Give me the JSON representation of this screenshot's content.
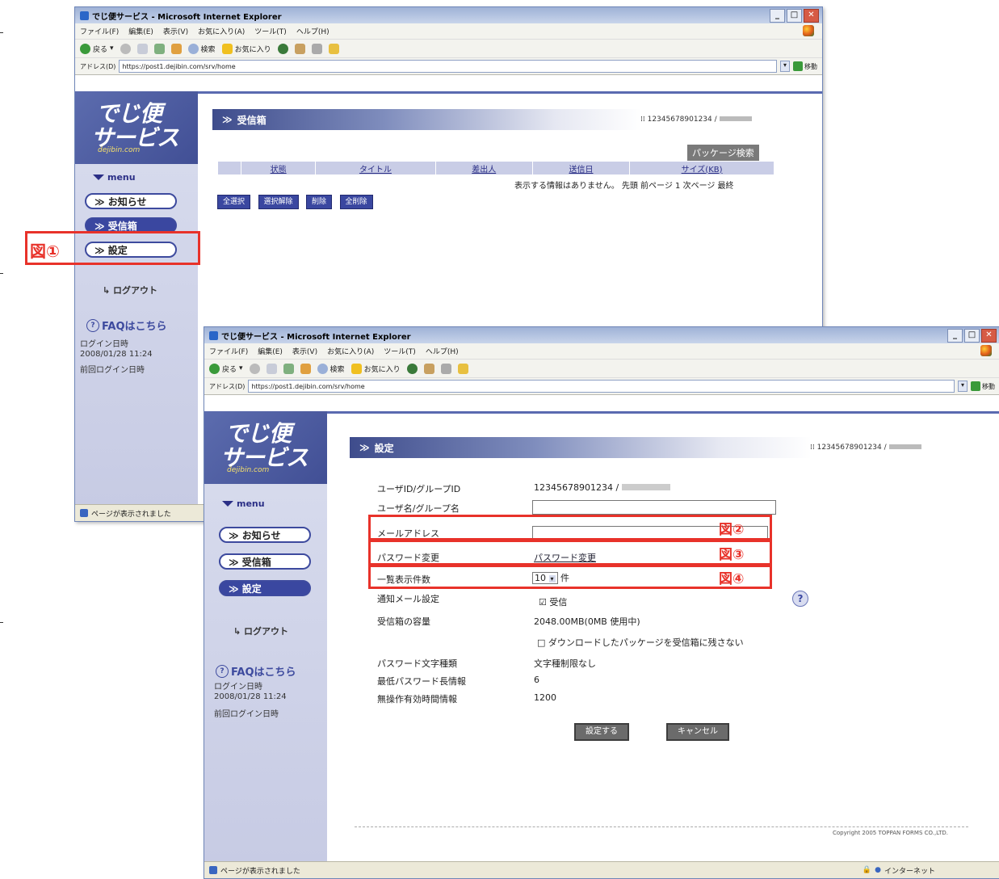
{
  "browser": {
    "title": "でじ便サービス - Microsoft Internet Explorer",
    "menu": [
      "ファイル(F)",
      "編集(E)",
      "表示(V)",
      "お気に入り(A)",
      "ツール(T)",
      "ヘルプ(H)"
    ],
    "toolbar": {
      "back": "戻る",
      "search": "検索",
      "favorites": "お気に入り"
    },
    "address_label": "アドレス(D)",
    "address_url": "https://post1.dejibin.com/srv/home",
    "go_label": "移動",
    "status_text": "ページが表示されました",
    "zone_text": "インターネット"
  },
  "logo": {
    "line1": "でじ便",
    "line2": "サービス",
    "line3": "dejibin.com"
  },
  "sidebar": {
    "menu_title": "menu",
    "items": [
      {
        "label": "≫ お知らせ"
      },
      {
        "label": "≫ 受信箱"
      },
      {
        "label": "≫ 設定"
      }
    ],
    "logout": "ログアウト",
    "faq": "FAQはこちら",
    "login_label": "ログイン日時",
    "login_date": "2008/01/28 11:24",
    "prev_login": "前回ログイン日時"
  },
  "window1": {
    "panel_title": "受信箱",
    "user_id": "12345678901234 /",
    "package_search": "パッケージ検索",
    "columns": [
      "状態",
      "タイトル",
      "差出人",
      "送信日",
      "サイズ(KB)"
    ],
    "no_records": "表示する情報はありません。 先頭 前ページ 1 次ページ 最終",
    "buttons": [
      "全選択",
      "選択解除",
      "削除",
      "全削除"
    ]
  },
  "window2": {
    "panel_title": "設定",
    "user_id": "12345678901234 /",
    "rows": [
      {
        "label": "ユーザID/グループID",
        "value": "12345678901234 /"
      },
      {
        "label": "ユーザ名/グループ名",
        "value": ""
      },
      {
        "label": "メールアドレス",
        "value": ""
      },
      {
        "label": "パスワード変更",
        "value": "パスワード変更"
      },
      {
        "label": "一覧表示件数",
        "value": "10",
        "suffix": "件"
      },
      {
        "label": "通知メール設定",
        "value": "☑ 受信"
      },
      {
        "label": "受信箱の容量",
        "value": "2048.00MB(0MB 使用中)"
      },
      {
        "label": "",
        "value": "□ ダウンロードしたパッケージを受信箱に残さない"
      },
      {
        "label": "パスワード文字種類",
        "value": "文字種制限なし"
      },
      {
        "label": "最低パスワード長情報",
        "value": "6"
      },
      {
        "label": "無操作有効時間情報",
        "value": "1200"
      }
    ],
    "save_button": "設定する",
    "cancel_button": "キャンセル",
    "copyright": "Copyright 2005 TOPPAN FORMS CO.,LTD."
  },
  "annotations": {
    "fig1": "図①",
    "fig2": "図②",
    "fig3": "図③",
    "fig4": "図④"
  },
  "colors": {
    "accent": "#3a47a0",
    "annotation": "#e8322a",
    "sidebar": "#d0d4ea"
  }
}
